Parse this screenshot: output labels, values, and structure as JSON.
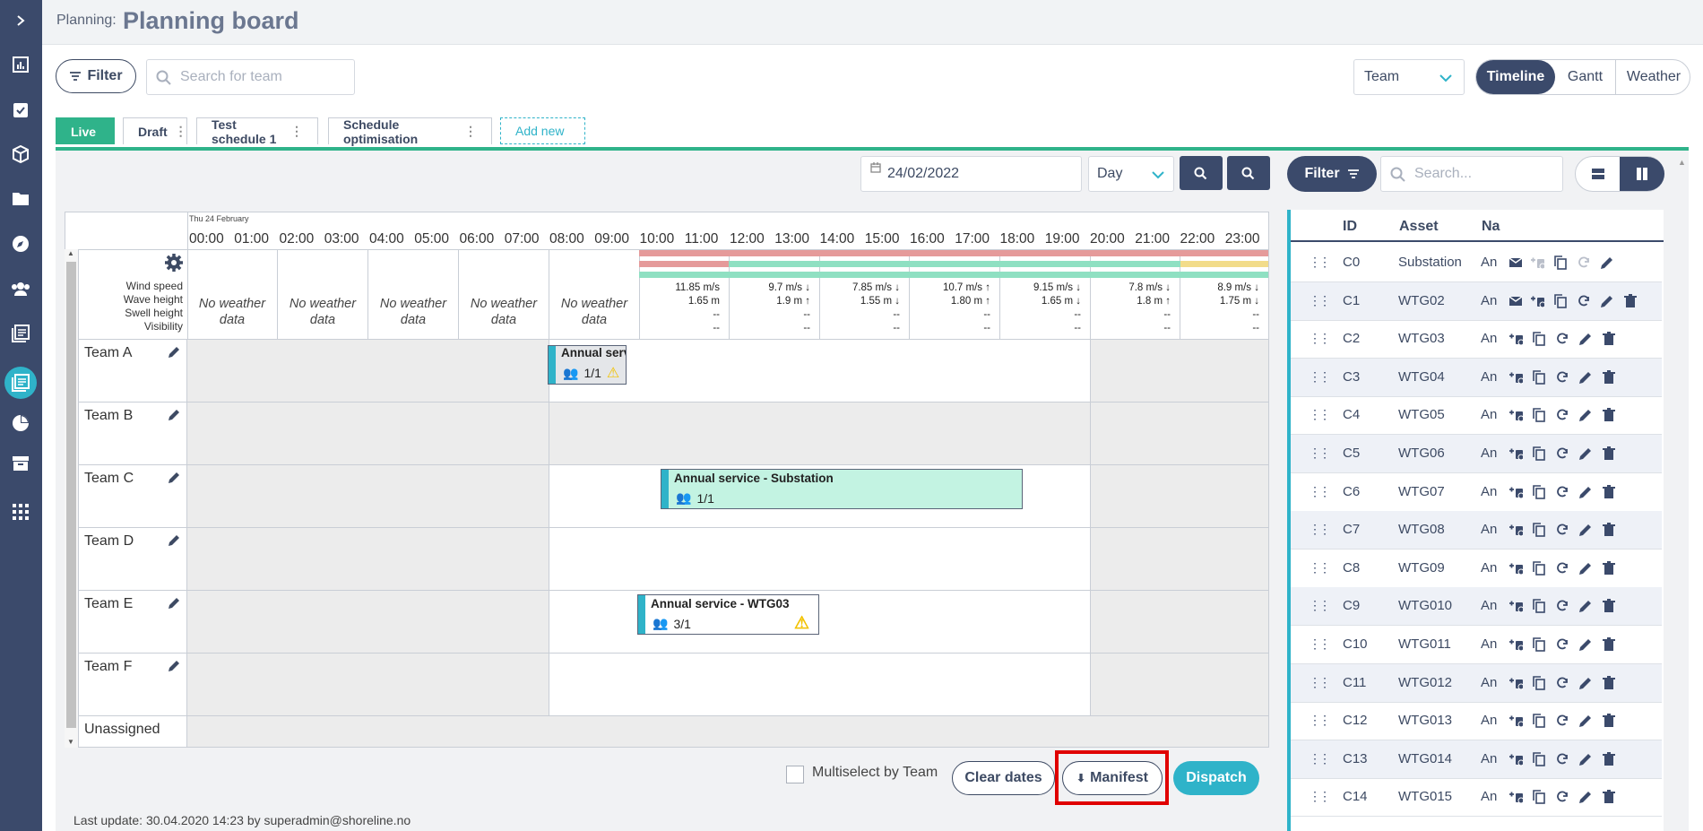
{
  "header": {
    "breadcrumb": "Planning:",
    "title": "Planning board"
  },
  "toolbar": {
    "filter_label": "Filter",
    "search_placeholder": "Search for team",
    "group_select": "Team",
    "views": [
      "Timeline",
      "Gantt",
      "Weather"
    ]
  },
  "tabs": [
    {
      "label": "Live"
    },
    {
      "label": "Draft"
    },
    {
      "label": "Test schedule 1"
    },
    {
      "label": "Schedule optimisation"
    },
    {
      "label": "Add new"
    }
  ],
  "date_bar": {
    "date": "24/02/2022",
    "range": "Day"
  },
  "timeline": {
    "day_label": "Thu 24 February",
    "hours": [
      "00:00",
      "01:00",
      "02:00",
      "03:00",
      "04:00",
      "05:00",
      "06:00",
      "07:00",
      "08:00",
      "09:00",
      "10:00",
      "11:00",
      "12:00",
      "13:00",
      "14:00",
      "15:00",
      "16:00",
      "17:00",
      "18:00",
      "19:00",
      "20:00",
      "21:00",
      "22:00",
      "23:00"
    ],
    "weather_labels": [
      "Wind speed",
      "Wave height",
      "Swell height",
      "Visibility"
    ],
    "no_weather": "No weather data",
    "weather": [
      {
        "wind": "11.85 m/s",
        "wave": "1.65 m",
        "swell": "--",
        "vis": "--"
      },
      {
        "wind": "9.7 m/s ↓",
        "wave": "1.9 m ↑",
        "swell": "--",
        "vis": "--"
      },
      {
        "wind": "7.85 m/s ↓",
        "wave": "1.55 m ↓",
        "swell": "--",
        "vis": "--"
      },
      {
        "wind": "10.7 m/s ↑",
        "wave": "1.80 m ↑",
        "swell": "--",
        "vis": "--"
      },
      {
        "wind": "9.15 m/s ↓",
        "wave": "1.65 m ↓",
        "swell": "--",
        "vis": "--"
      },
      {
        "wind": "7.8 m/s ↓",
        "wave": "1.8 m ↑",
        "swell": "--",
        "vis": "--"
      },
      {
        "wind": "8.9 m/s ↓",
        "wave": "1.75 m ↓",
        "swell": "--",
        "vis": "--"
      }
    ],
    "teams": [
      "Team A",
      "Team B",
      "Team C",
      "Team D",
      "Team E",
      "Team F",
      "Unassigned"
    ],
    "tasks": [
      {
        "name": "Annual serv",
        "count": "1/1"
      },
      {
        "name": "Annual service - Substation",
        "count": "1/1"
      },
      {
        "name": "Annual service - WTG03",
        "count": "3/1"
      }
    ]
  },
  "footer": {
    "multiselect": "Multiselect by Team",
    "clear": "Clear dates",
    "manifest": "Manifest",
    "dispatch": "Dispatch",
    "last_update": "Last update: 30.04.2020 14:23 by superadmin@shoreline.no"
  },
  "right_panel": {
    "filter_label": "Filter",
    "search_placeholder": "Search...",
    "columns": [
      "ID",
      "Asset",
      "Na"
    ],
    "rows": [
      {
        "id": "C0",
        "asset": "Substation",
        "name": "An"
      },
      {
        "id": "C1",
        "asset": "WTG02",
        "name": "An"
      },
      {
        "id": "C2",
        "asset": "WTG03",
        "name": "An"
      },
      {
        "id": "C3",
        "asset": "WTG04",
        "name": "An"
      },
      {
        "id": "C4",
        "asset": "WTG05",
        "name": "An"
      },
      {
        "id": "C5",
        "asset": "WTG06",
        "name": "An"
      },
      {
        "id": "C6",
        "asset": "WTG07",
        "name": "An"
      },
      {
        "id": "C7",
        "asset": "WTG08",
        "name": "An"
      },
      {
        "id": "C8",
        "asset": "WTG09",
        "name": "An"
      },
      {
        "id": "C9",
        "asset": "WTG010",
        "name": "An"
      },
      {
        "id": "C10",
        "asset": "WTG011",
        "name": "An"
      },
      {
        "id": "C11",
        "asset": "WTG012",
        "name": "An"
      },
      {
        "id": "C12",
        "asset": "WTG013",
        "name": "An"
      },
      {
        "id": "C13",
        "asset": "WTG014",
        "name": "An"
      },
      {
        "id": "C14",
        "asset": "WTG015",
        "name": "An"
      }
    ]
  },
  "colors": {
    "navy": "#3b4a6b",
    "teal": "#2fb3c9",
    "green": "#2fb38a",
    "highlight": "#e00000"
  }
}
